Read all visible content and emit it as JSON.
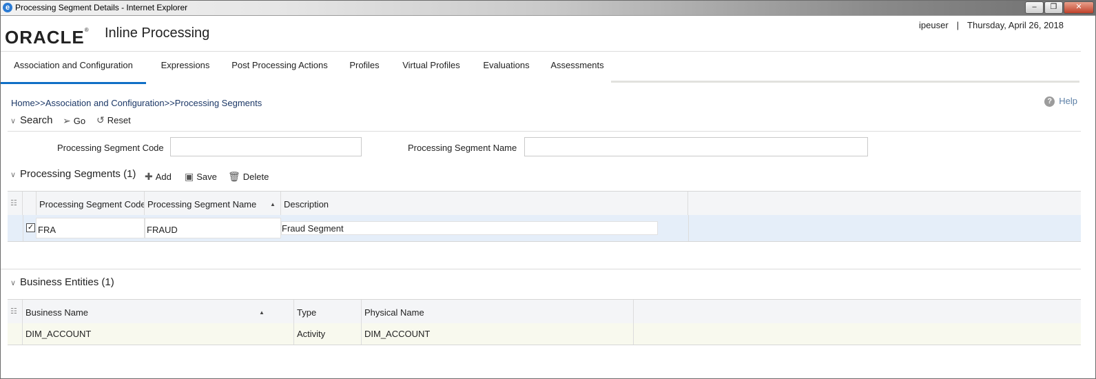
{
  "window": {
    "title": "Processing Segment Details - Internet Explorer",
    "min": "‒",
    "max": "❐",
    "close": "✕"
  },
  "header": {
    "logo": "ORACLE",
    "app_title": "Inline Processing",
    "user": "ipeuser",
    "separator": "|",
    "date": "Thursday, April 26, 2018"
  },
  "tabs": [
    {
      "label": "Association and Configuration"
    },
    {
      "label": "Expressions"
    },
    {
      "label": "Post Processing Actions"
    },
    {
      "label": "Profiles"
    },
    {
      "label": "Virtual Profiles"
    },
    {
      "label": "Evaluations"
    },
    {
      "label": "Assessments"
    }
  ],
  "breadcrumb": "Home>>Association and Configuration>>Processing Segments",
  "help": {
    "icon": "help-icon",
    "label": "Help"
  },
  "search": {
    "title": "Search",
    "go_label": "Go",
    "reset_label": "Reset",
    "code_label": "Processing Segment Code",
    "code_value": "",
    "name_label": "Processing Segment Name",
    "name_value": ""
  },
  "segments": {
    "title": "Processing Segments",
    "count": "(1)",
    "add_label": "Add",
    "save_label": "Save",
    "delete_label": "Delete",
    "columns": [
      "Processing Segment Code",
      "Processing Segment Name",
      "Description"
    ],
    "rows": [
      {
        "checked": true,
        "code": "FRA",
        "name": "FRAUD",
        "description": "Fraud Segment"
      }
    ]
  },
  "entities": {
    "title": "Business Entities",
    "count": "(1)",
    "columns": [
      "Business Name",
      "Type",
      "Physical Name"
    ],
    "rows": [
      {
        "business_name": "DIM_ACCOUNT",
        "type": "Activity",
        "physical_name": "DIM_ACCOUNT"
      }
    ]
  },
  "colors": {
    "accent": "#0f6fc6",
    "selected_row": "#e5eef9",
    "entity_row": "#f8f9ee"
  }
}
